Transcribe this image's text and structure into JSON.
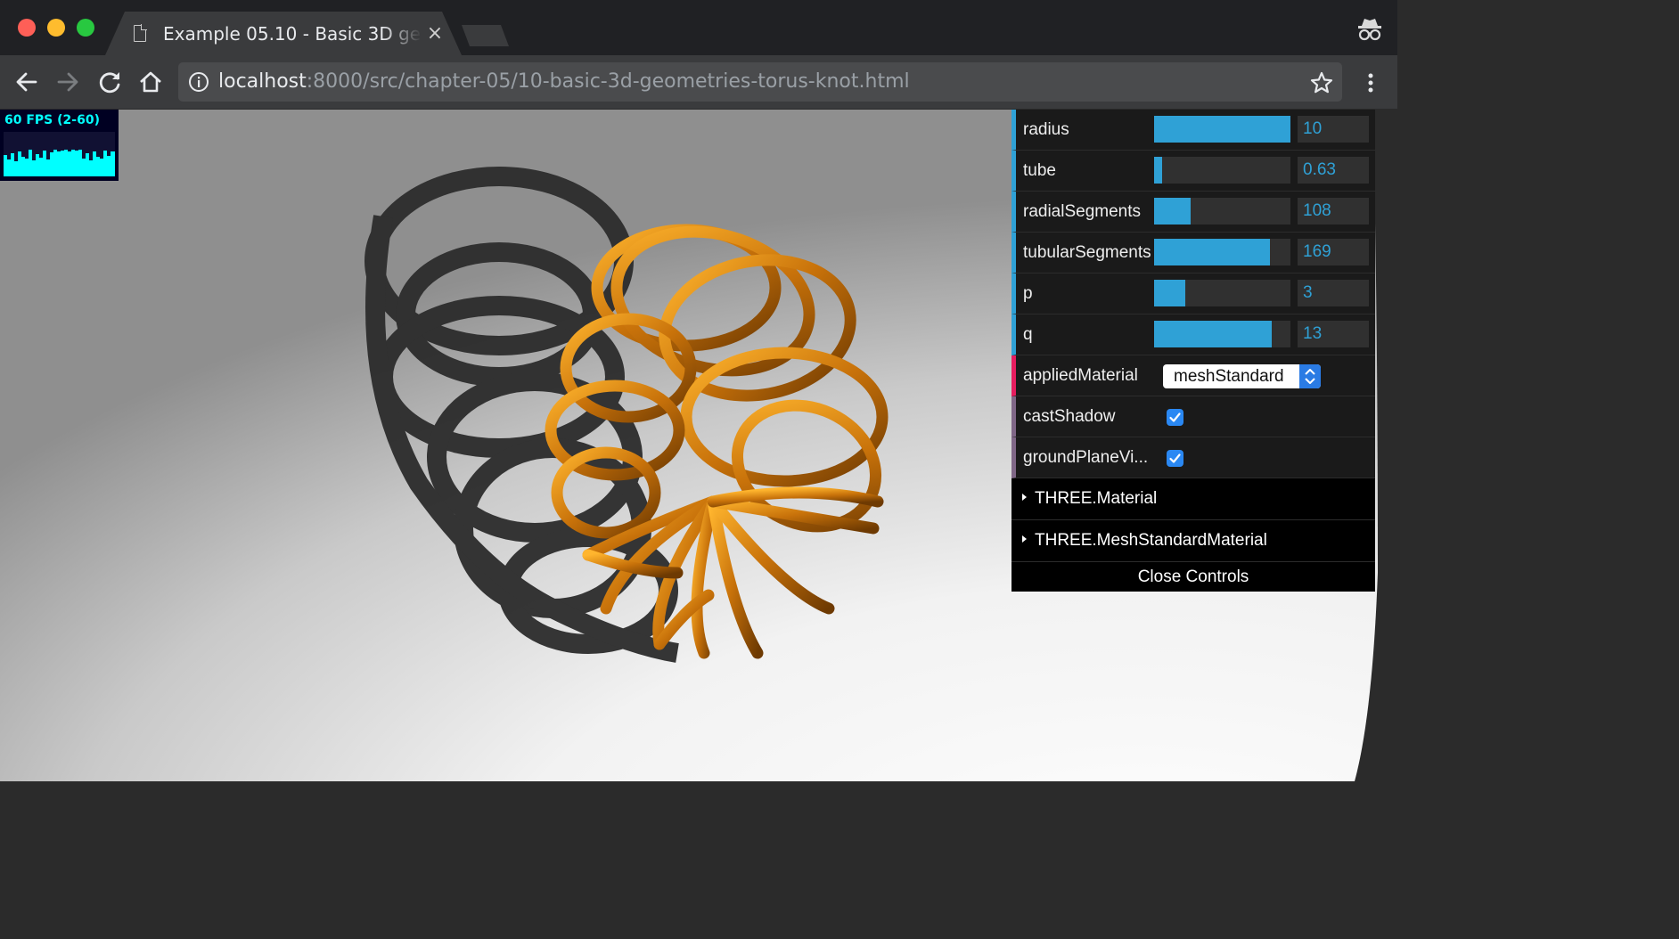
{
  "browser": {
    "tab_title": "Example 05.10 - Basic 3D geometries - Torus Knot",
    "tab_close": "×",
    "url_host": "localhost",
    "url_rest": ":8000/src/chapter-05/10-basic-3d-geometries-torus-knot.html"
  },
  "stats": {
    "label": "60 FPS (2-60)"
  },
  "controls": {
    "rows": [
      {
        "label": "radius",
        "value": "10",
        "fill": 1.0
      },
      {
        "label": "tube",
        "value": "0.63",
        "fill": 0.06
      },
      {
        "label": "radialSegments",
        "value": "108",
        "fill": 0.27
      },
      {
        "label": "tubularSegments",
        "value": "169",
        "fill": 0.85
      },
      {
        "label": "p",
        "value": "3",
        "fill": 0.23
      },
      {
        "label": "q",
        "value": "13",
        "fill": 0.86
      }
    ],
    "applied_material_label": "appliedMaterial",
    "applied_material_value": "meshStandard",
    "cast_shadow_label": "castShadow",
    "cast_shadow_checked": true,
    "ground_plane_label": "groundPlaneVi...",
    "ground_plane_checked": true,
    "folders": [
      "THREE.Material",
      "THREE.MeshStandardMaterial"
    ],
    "close_label": "Close Controls"
  },
  "colors": {
    "accent": "#2fa1d6",
    "knot": "#c8720a",
    "stats_fg": "#00ffff"
  }
}
